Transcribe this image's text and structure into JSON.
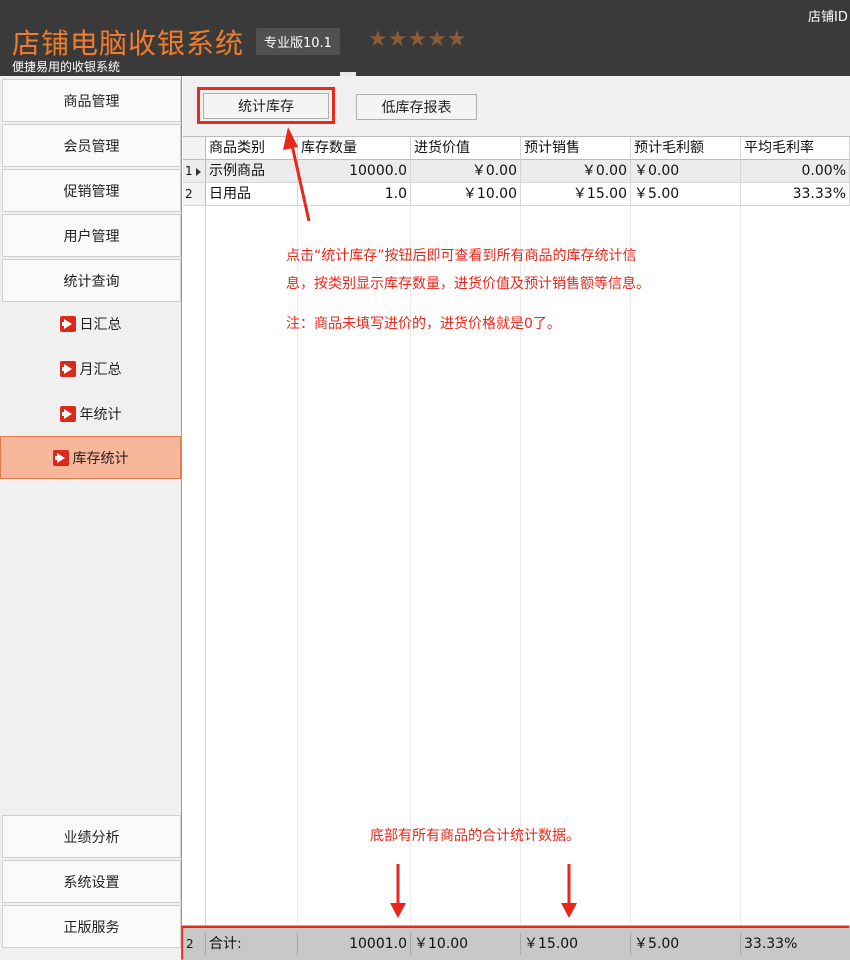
{
  "header": {
    "title": "店铺电脑收银系统",
    "edition": "专业版10.1",
    "rating_stars": "★★★★★",
    "subtitle": "便捷易用的收银系统",
    "shop_id_label": "店铺ID"
  },
  "sidebar": {
    "items": [
      {
        "label": "商品管理"
      },
      {
        "label": "会员管理"
      },
      {
        "label": "促销管理"
      },
      {
        "label": "用户管理"
      },
      {
        "label": "统计查询"
      }
    ],
    "sub_items": [
      {
        "label": "日汇总"
      },
      {
        "label": "月汇总"
      },
      {
        "label": "年统计"
      },
      {
        "label": "库存统计",
        "active": true
      }
    ],
    "bottom_items": [
      {
        "label": "业绩分析"
      },
      {
        "label": "系统设置"
      },
      {
        "label": "正版服务"
      }
    ]
  },
  "toolbar": {
    "stock_stats_label": "统计库存",
    "low_stock_label": "低库存报表"
  },
  "grid": {
    "columns": [
      "商品类别",
      "库存数量",
      "进货价值",
      "预计销售",
      "预计毛利额",
      "平均毛利率"
    ],
    "rows": [
      {
        "index": "1",
        "cells": [
          "示例商品",
          "10000.0",
          "￥0.00",
          "￥0.00",
          "￥0.00",
          "0.00%"
        ]
      },
      {
        "index": "2",
        "cells": [
          "日用品",
          "1.0",
          "￥10.00",
          "￥15.00",
          "￥5.00",
          "33.33%"
        ]
      }
    ]
  },
  "totals": {
    "index": "2",
    "cells": [
      "合计:",
      "10001.0",
      "￥10.00",
      "￥15.00",
      "￥5.00",
      "33.33%"
    ]
  },
  "annotations": {
    "note_line1": "点击“统计库存”按钮后即可查看到所有商品的库存统计信",
    "note_line2": "息，按类别显示库存数量，进货价值及预计销售额等信息。",
    "note_line3": "注：商品未填写进价的，进货价格就是0了。",
    "note_bottom": "底部有所有商品的合计统计数据。"
  },
  "colors": {
    "accent": "#f07d2e",
    "header_bg": "#3a3a3a",
    "annotation_red": "#e8281a",
    "active_item_bg": "#f8b79a"
  }
}
